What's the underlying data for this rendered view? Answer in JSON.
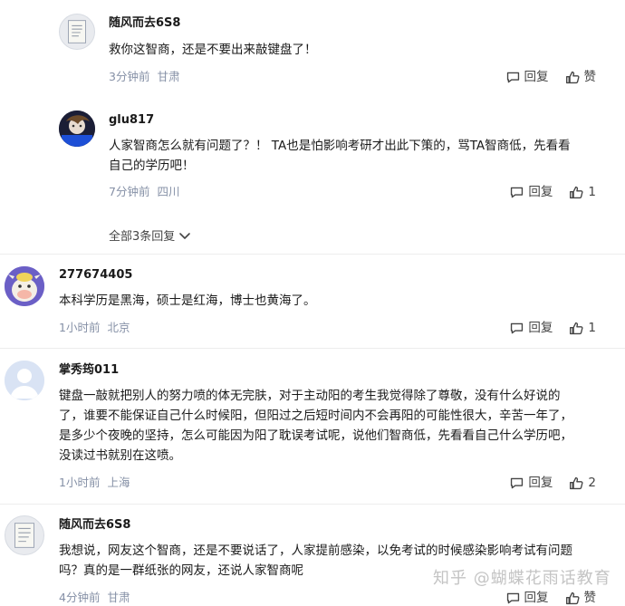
{
  "comments": [
    {
      "author": "随风而去6S8",
      "lines": [
        "救你这智商，还是不要出来敲键盘了！"
      ],
      "time": "3分钟前",
      "location": "甘肃",
      "reply_label": "回复",
      "like_label": "赞",
      "avatar": "paper-note-avatar"
    },
    {
      "author": "glu817",
      "lines": [
        "人家智商怎么就有问题了？！ TA也是怕影响考研才出此下策的，骂TA智商低，先看看",
        "自己的学历吧！"
      ],
      "time": "7分钟前",
      "location": "四川",
      "reply_label": "回复",
      "like_label": "1",
      "avatar": "dark-anime-avatar"
    },
    {
      "author": "277674405",
      "lines": [
        "本科学历是黑海，硕士是红海，博士也黄海了。"
      ],
      "time": "1小时前",
      "location": "北京",
      "reply_label": "回复",
      "like_label": "1",
      "avatar": "cartoon-cow-avatar"
    },
    {
      "author": "掌秀筠011",
      "lines": [
        "键盘一敲就把别人的努力喷的体无完肤，对于主动阳的考生我觉得除了尊敬，没有什么好说的",
        "了，谁要不能保证自己什么时候阳，但阳过之后短时间内不会再阳的可能性很大，辛苦一年了，",
        "是多少个夜晚的坚持，怎么可能因为阳了耽误考试呢，说他们智商低，先看看自己什么学历吧，",
        "没读过书就别在这喷。"
      ],
      "time": "1小时前",
      "location": "上海",
      "reply_label": "回复",
      "like_label": "2",
      "avatar": "default-user-avatar"
    },
    {
      "author": "随风而去6S8",
      "lines": [
        "我想说，网友这个智商，还是不要说话了，人家提前感染，以免考试的时候感染影响考试有问题",
        "吗？真的是一群纸张的网友，还说人家智商呢"
      ],
      "time": "4分钟前",
      "location": "甘肃",
      "reply_label": "回复",
      "like_label": "赞",
      "avatar": "paper-note-avatar"
    }
  ],
  "expand_replies": "全部3条回复",
  "watermark": "知乎 @蝴蝶花雨话教育",
  "colors": {
    "meta": "#8590a6",
    "text": "#1a1a1a",
    "divider": "#ededed"
  }
}
